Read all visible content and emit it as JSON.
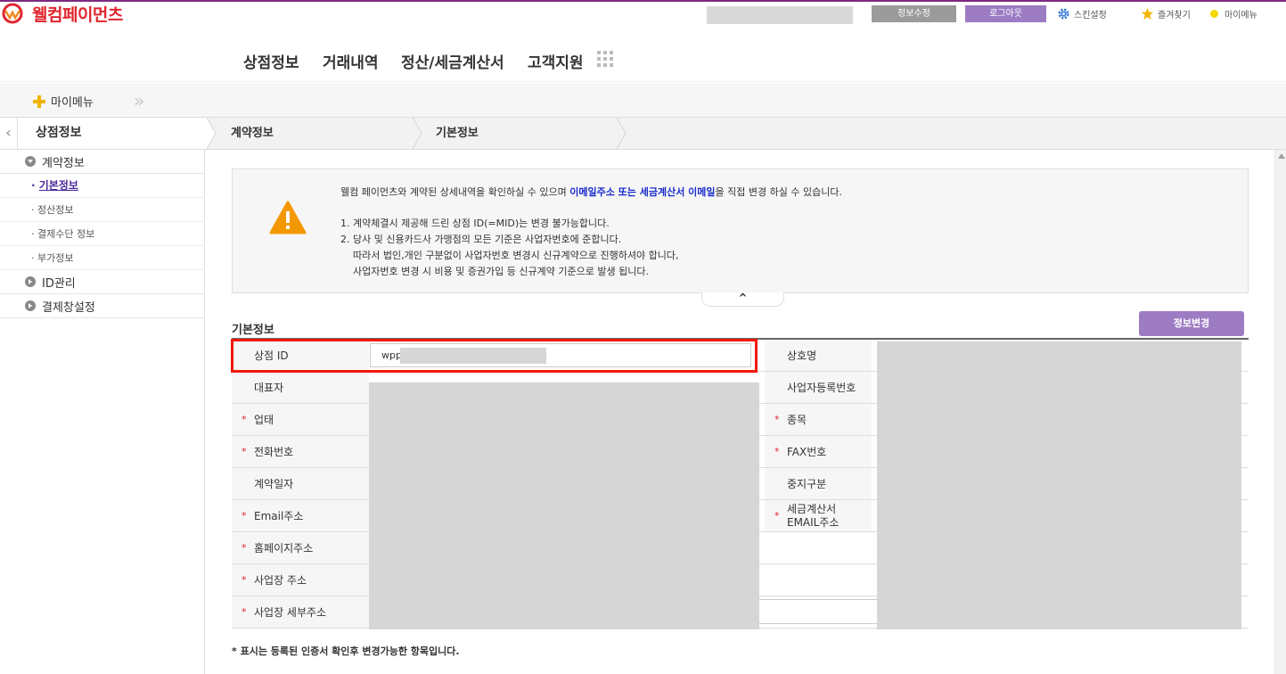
{
  "header": {
    "logo_text": "웰컴페이먼츠",
    "edit_info_label": "정보수정",
    "logout_label": "로그아웃",
    "skin_label": "스킨설정",
    "favorites_label": "즐겨찾기",
    "mymenu_label": "마이메뉴"
  },
  "nav": {
    "items": [
      "상점정보",
      "거래내역",
      "정산/세금계산서",
      "고객지원"
    ]
  },
  "mymenu_bar": {
    "label": "마이메뉴"
  },
  "breadcrumb": {
    "section": "상점정보",
    "items": [
      "계약정보",
      "기본정보"
    ]
  },
  "sidebar": {
    "groups": [
      {
        "label": "계약정보",
        "expanded": true,
        "items": [
          "기본정보",
          "정산정보",
          "결제수단 정보",
          "부가정보"
        ],
        "active": "기본정보"
      },
      {
        "label": "ID관리",
        "expanded": false
      },
      {
        "label": "결제창설정",
        "expanded": false
      }
    ]
  },
  "notice": {
    "line1_prefix": "웰컴 페이먼츠와 계약된 상세내역을 확인하실 수 있으며 ",
    "line1_highlight": "이메일주소 또는 세금계산서 이메일",
    "line1_suffix": "을 직접 변경 하실 수 있습니다.",
    "item1": "1. 계약체결시 제공해 드린 상점 ID(=MID)는 변경 불가능합니다.",
    "item2": "2. 당사 및 신용카드사 가맹점의 모든 기준은 사업자번호에 준합니다.",
    "item2_cont1": "따라서 법인,개인 구분없이 사업자번호 변경시 신규계약으로 진행하셔야 합니다,",
    "item2_cont2": "사업자번호 변경 시 비용 및 증권가입 등 신규계약 기준으로 발생 됩니다.",
    "collapse_glyph": "^"
  },
  "section": {
    "title": "기본정보",
    "change_button": "정보변경",
    "required_mark": "*"
  },
  "table": {
    "merchant_id_label": "상점 ID",
    "merchant_id_value": "wpp",
    "company_name_label": "상호명",
    "ceo_label": "대표자",
    "biz_reg_label": "사업자등록번호",
    "biz_type_label": "업태",
    "biz_item_label": "종목",
    "phone_label": "전화번호",
    "fax_label": "FAX번호",
    "contract_date_label": "계약일자",
    "stop_type_label": "중지구분",
    "email_label": "Email주소",
    "tax_email_label_line1": "세금계산서",
    "tax_email_label_line2": "EMAIL주소",
    "homepage_label": "홈페이지주소",
    "address_label": "사업장 주소",
    "address_detail_label": "사업장 세부주소"
  },
  "footnote": "* 표시는 등록된 인증서 확인후 변경가능한 항목입니다.",
  "colors": {
    "brand_red": "#e0262f",
    "accent_purple": "#9e7cc4",
    "highlight_blue": "#1a2ccc",
    "annotation_red": "#f0190a"
  }
}
